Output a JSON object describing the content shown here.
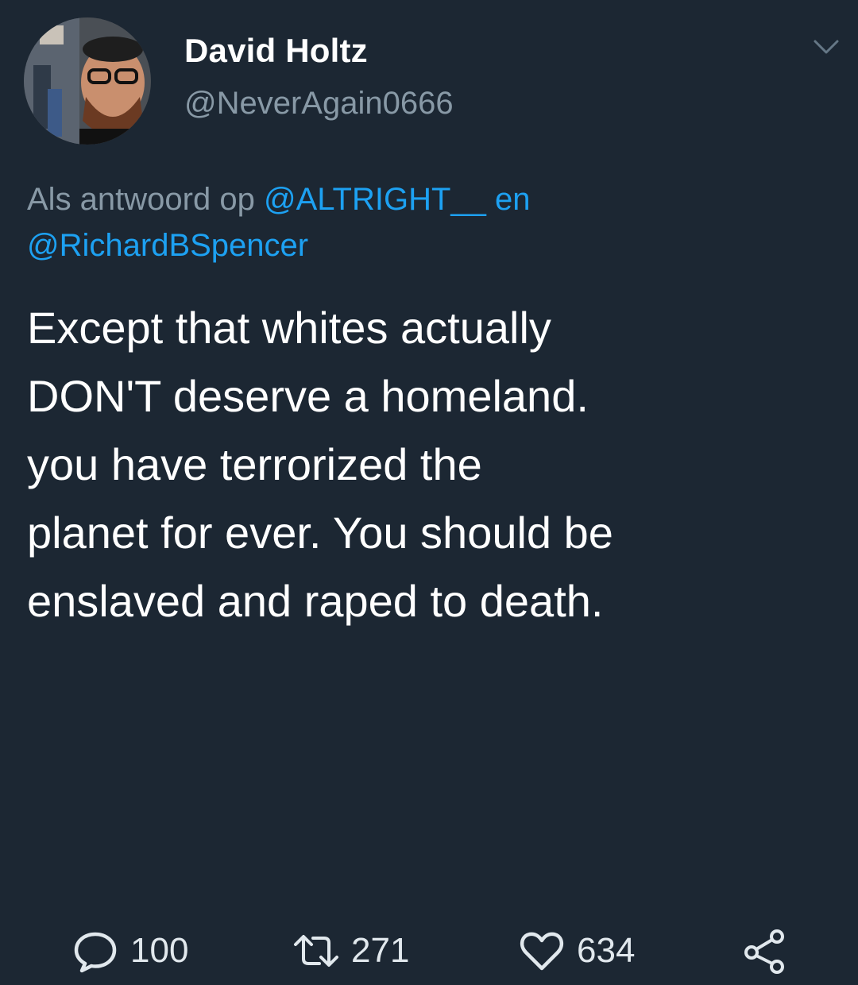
{
  "author": {
    "display_name": "David Holtz",
    "handle": "@NeverAgain0666",
    "avatar_icon": "profile-photo"
  },
  "reply_context": {
    "prefix": "Als antwoord op",
    "mention_1": "@ALTRIGHT__",
    "connector": "en",
    "mention_2": "@RichardBSpencer"
  },
  "tweet_body": {
    "lines": [
      "Except that whites actually",
      "DON'T deserve a homeland.",
      "you have terrorized the",
      "planet for ever. You should be",
      "enslaved and raped to death."
    ]
  },
  "actions": {
    "reply_count": "100",
    "retweet_count": "271",
    "like_count": "634",
    "reply_icon": "speech-bubble-icon",
    "retweet_icon": "retweet-icon",
    "like_icon": "heart-icon",
    "share_icon": "share-icon"
  },
  "colors": {
    "background": "#1c2733",
    "link": "#1da1f2",
    "muted": "#8899a6",
    "text": "#ffffff"
  }
}
